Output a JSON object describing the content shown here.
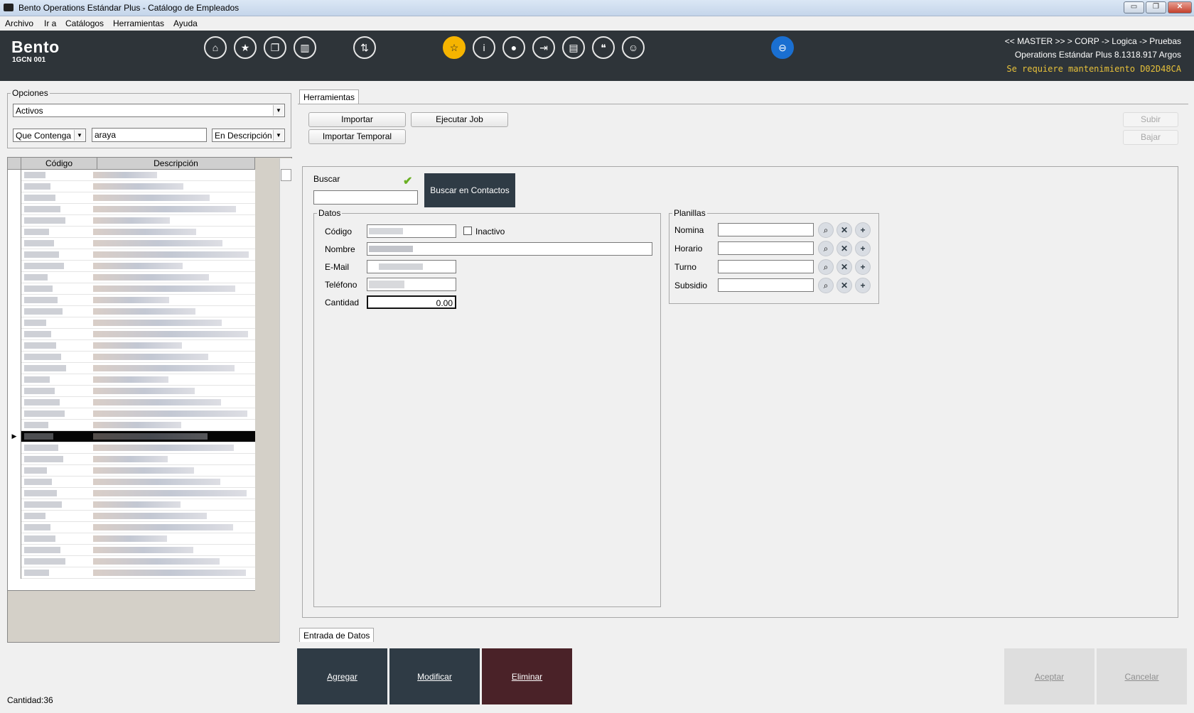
{
  "window": {
    "title": "Bento Operations Estándar Plus - Catálogo de Empleados",
    "minimize": "▭",
    "restore": "❐",
    "close": "✕"
  },
  "menu": [
    "Archivo",
    "Ir a",
    "Catálogos",
    "Herramientas",
    "Ayuda"
  ],
  "brand": {
    "name": "Bento",
    "sub": "1GCN 001"
  },
  "toolbar_icons": [
    "home-icon",
    "star-icon",
    "copy-icon",
    "book-icon",
    "sort-icon",
    "award-icon",
    "info-icon",
    "bulb-icon",
    "login-icon",
    "id-card-icon",
    "quote-icon",
    "support-icon",
    "minus-circle-icon"
  ],
  "context": {
    "path": "<< MASTER >> > CORP -> Logica -> Pruebas",
    "version": "Operations Estándar Plus 8.1318.917 Argos",
    "warning": "Se requiere mantenimiento D02D48CA"
  },
  "opciones": {
    "legend": "Opciones",
    "status_value": "Activos",
    "filter_mode": "Que Contenga",
    "filter_text": "araya",
    "filter_field": "En Descripción"
  },
  "grid": {
    "columns": [
      "Código",
      "Descripción"
    ],
    "row_count": 36,
    "selected_row_index": 23
  },
  "footer": {
    "count_label": "Cantidad:36"
  },
  "herramientas": {
    "tab": "Herramientas",
    "importar": "Importar",
    "ejecutar_job": "Ejecutar Job",
    "importar_temporal": "Importar Temporal",
    "subir": "Subir",
    "bajar": "Bajar"
  },
  "form": {
    "buscar_label": "Buscar",
    "buscar_value": "",
    "buscar_contactos": "Buscar en Contactos",
    "datos_legend": "Datos",
    "codigo_label": "Código",
    "inactivo_label": "Inactivo",
    "nombre_label": "Nombre",
    "email_label": "E-Mail",
    "telefono_label": "Teléfono",
    "cantidad_label": "Cantidad",
    "cantidad_value": "0.00",
    "planillas_legend": "Planillas",
    "planillas": [
      "Nomina",
      "Horario",
      "Turno",
      "Subsidio"
    ]
  },
  "bottom_tab": "Entrada de Datos",
  "actions": {
    "agregar": "Agregar",
    "modificar": "Modificar",
    "eliminar": "Eliminar",
    "aceptar": "Aceptar",
    "cancelar": "Cancelar"
  },
  "colors": {
    "toolbar_bg": "#2e3439",
    "accent_yellow": "#f6b400",
    "accent_blue": "#1a6fd1",
    "warning_text": "#e7c13a",
    "action_dark": "#2f3b45",
    "action_delete": "#4a2228"
  }
}
